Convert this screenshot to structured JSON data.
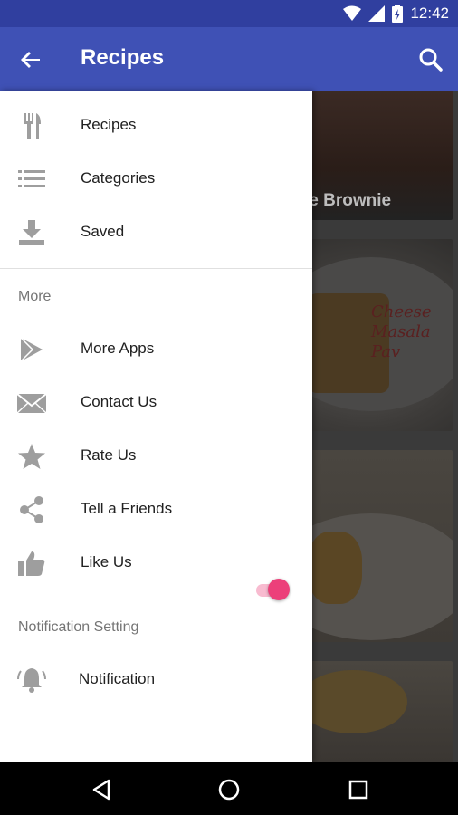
{
  "status_bar": {
    "time": "12:42"
  },
  "app_bar": {
    "title": "Recipes"
  },
  "drawer": {
    "main_items": [
      {
        "label": "Recipes",
        "icon": "fork-knife-icon"
      },
      {
        "label": "Categories",
        "icon": "list-icon"
      },
      {
        "label": "Saved",
        "icon": "download-icon"
      }
    ],
    "more_header": "More",
    "more_items": [
      {
        "label": "More Apps",
        "icon": "play-store-icon"
      },
      {
        "label": "Contact Us",
        "icon": "mail-icon"
      },
      {
        "label": "Rate Us",
        "icon": "star-icon"
      },
      {
        "label": "Tell a Friends",
        "icon": "share-icon"
      },
      {
        "label": "Like Us",
        "icon": "thumbs-up-icon"
      }
    ],
    "notification_header": "Notification Setting",
    "notification": {
      "label": "Notification",
      "icon": "bell-icon",
      "enabled": true
    }
  },
  "background_cards": [
    {
      "caption": "Chocolate Brownie"
    },
    {
      "script_text": "Cheese Masala Pav"
    }
  ],
  "colors": {
    "status_bar": "#303f9f",
    "app_bar": "#3f51b5",
    "toggle_thumb": "#ec407a",
    "toggle_track": "#f8bbd0",
    "icon_gray": "#9e9e9e"
  }
}
